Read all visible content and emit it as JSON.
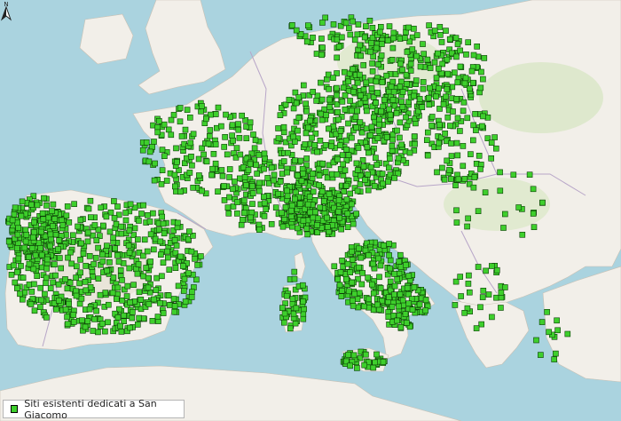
{
  "map": {
    "background_sea": "#aad3df",
    "land_color": "#f2efe9",
    "forest_color": "#cfe3b3",
    "country_border_color": "#b8a6c8",
    "marker_fill": "#3ecf2c",
    "marker_stroke": "#0b3d06"
  },
  "north_arrow": {
    "icon": "north-arrow-icon"
  },
  "legend": {
    "label": "Siti esistenti dedicati a San Giacomo",
    "swatch_color": "#3ecf2c"
  }
}
